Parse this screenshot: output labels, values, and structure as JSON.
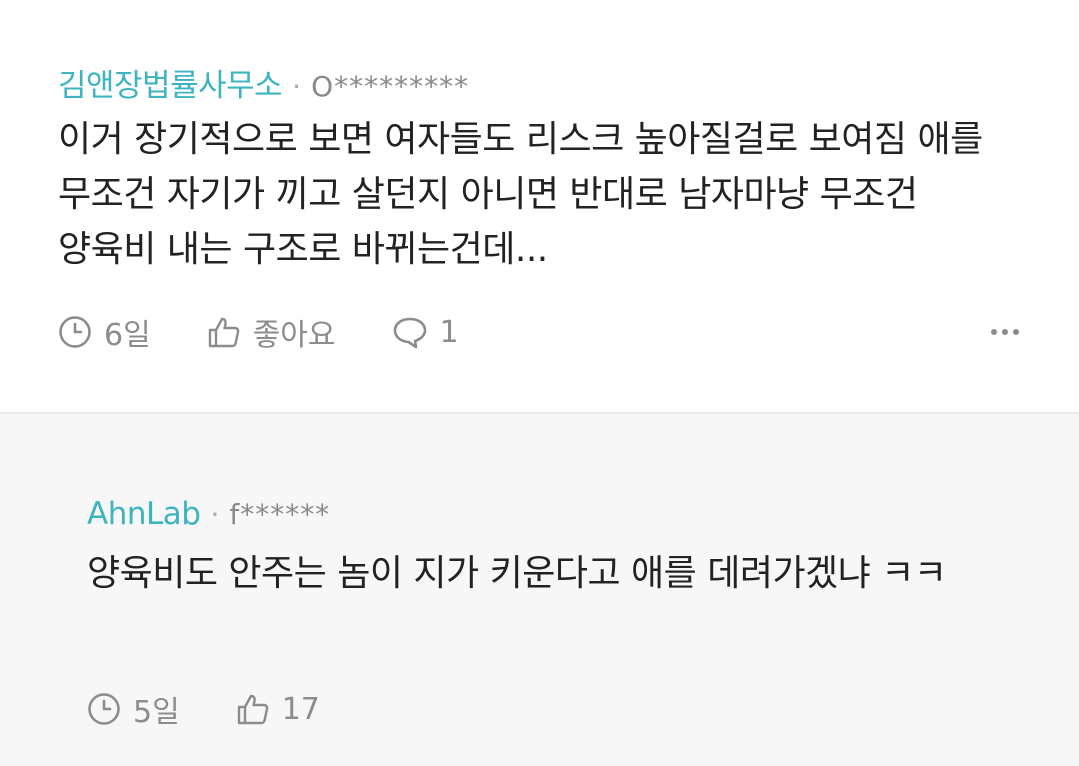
{
  "comments": [
    {
      "author": "김앤장법률사무소",
      "separator": "·",
      "user_id": "O*********",
      "text": "이거 장기적으로 보면 여자들도 리스크 높아질걸로 보여짐 애를 무조건 자기가 끼고 살던지 아니면 반대로 남자마냥 무조건 양육비 내는 구조로 바뀌는건데...",
      "time": "6일",
      "like_label": "좋아요",
      "reply_count": "1"
    },
    {
      "author": "AhnLab",
      "separator": "·",
      "user_id": "f******",
      "text": "양육비도 안주는 놈이 지가 키운다고 애를 데려가겠냐 ㅋㅋ",
      "time": "5일",
      "like_count": "17"
    }
  ],
  "icons": {
    "clock": "clock-icon",
    "thumb": "thumbs-up-icon",
    "bubble": "speech-bubble-icon",
    "more": "more-dots-icon"
  },
  "colors": {
    "author": "#3db4c0",
    "meta": "#8c8c8c",
    "reply_bg": "#f7f7f7"
  }
}
